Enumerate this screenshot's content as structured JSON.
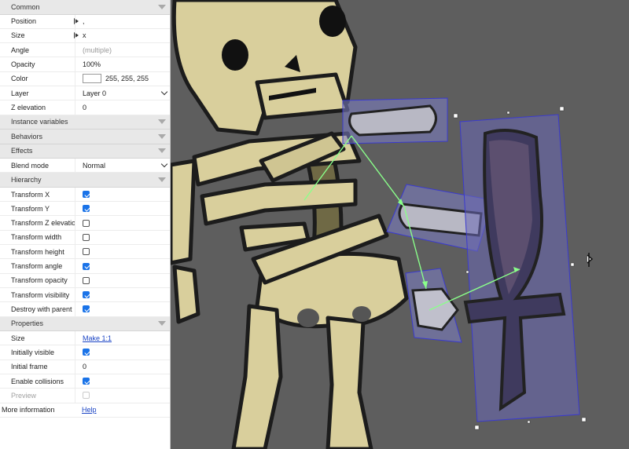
{
  "sections": {
    "common": "Common",
    "instance_variables": "Instance variables",
    "behaviors": "Behaviors",
    "effects": "Effects",
    "hierarchy": "Hierarchy",
    "properties": "Properties"
  },
  "common": {
    "position_label": "Position",
    "position_value": ",",
    "size_label": "Size",
    "size_value": "x",
    "angle_label": "Angle",
    "angle_value": "(multiple)",
    "opacity_label": "Opacity",
    "opacity_value": "100%",
    "color_label": "Color",
    "color_value": "255, 255, 255",
    "color_swatch": "#ffffff",
    "layer_label": "Layer",
    "layer_value": "Layer 0",
    "z_label": "Z elevation",
    "z_value": "0"
  },
  "effects": {
    "blend_label": "Blend mode",
    "blend_value": "Normal"
  },
  "hierarchy": {
    "items": [
      {
        "label": "Transform X",
        "checked": true
      },
      {
        "label": "Transform Y",
        "checked": true
      },
      {
        "label": "Transform Z elevation",
        "checked": false
      },
      {
        "label": "Transform width",
        "checked": false
      },
      {
        "label": "Transform height",
        "checked": false
      },
      {
        "label": "Transform angle",
        "checked": true
      },
      {
        "label": "Transform opacity",
        "checked": false
      },
      {
        "label": "Transform visibility",
        "checked": true
      },
      {
        "label": "Destroy with parent",
        "checked": true
      }
    ]
  },
  "properties": {
    "size_label": "Size",
    "size_link": "Make 1:1",
    "visible_label": "Initially visible",
    "visible_checked": true,
    "frame_label": "Initial frame",
    "frame_value": "0",
    "collisions_label": "Enable collisions",
    "collisions_checked": true,
    "preview_label": "Preview",
    "preview_checked": false
  },
  "footer": {
    "more_info_label": "More information",
    "help_link": "Help"
  },
  "colors": {
    "canvas_bg": "#5e5e5e",
    "accent": "#1a73e8",
    "selection": "#3a3ad0",
    "hierarchy_arrow": "#8aff8a"
  }
}
